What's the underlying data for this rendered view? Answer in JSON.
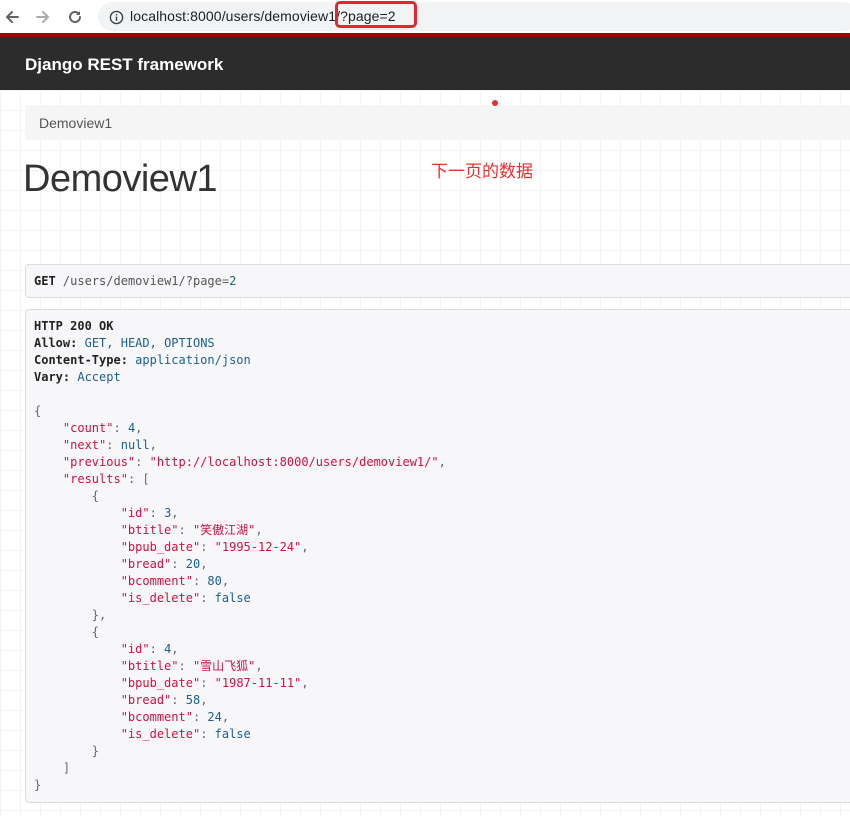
{
  "browser": {
    "url": "localhost:8000/users/demoview1/?page=2"
  },
  "navbar": {
    "brand": "Django REST framework"
  },
  "breadcrumb": {
    "items": [
      "Demoview1"
    ]
  },
  "annotation": {
    "text": "下一页的数据"
  },
  "page": {
    "title": "Demoview1"
  },
  "request": {
    "method": "GET",
    "path": "/users/demoview1/?page",
    "query_value": "2"
  },
  "response": {
    "status": "HTTP 200 OK",
    "headers": [
      {
        "name": "Allow",
        "value": "GET, HEAD, OPTIONS"
      },
      {
        "name": "Content-Type",
        "value": "application/json"
      },
      {
        "name": "Vary",
        "value": "Accept"
      }
    ],
    "body": {
      "count": 4,
      "next": null,
      "previous": "http://localhost:8000/users/demoview1/",
      "results": [
        {
          "id": 3,
          "btitle": "笑傲江湖",
          "bpub_date": "1995-12-24",
          "bread": 20,
          "bcomment": 80,
          "is_delete": false
        },
        {
          "id": 4,
          "btitle": "雪山飞狐",
          "bpub_date": "1987-11-11",
          "bread": 58,
          "bcomment": 24,
          "is_delete": false
        }
      ]
    }
  },
  "colors": {
    "navbar_bg": "#2c2c2c",
    "accent_strip": "#a30000",
    "annotation_red": "#e8302f",
    "json_key": "#d01040",
    "json_value": "#195f91"
  },
  "icons": [
    "back-arrow-icon",
    "forward-arrow-icon",
    "reload-icon",
    "info-icon"
  ]
}
